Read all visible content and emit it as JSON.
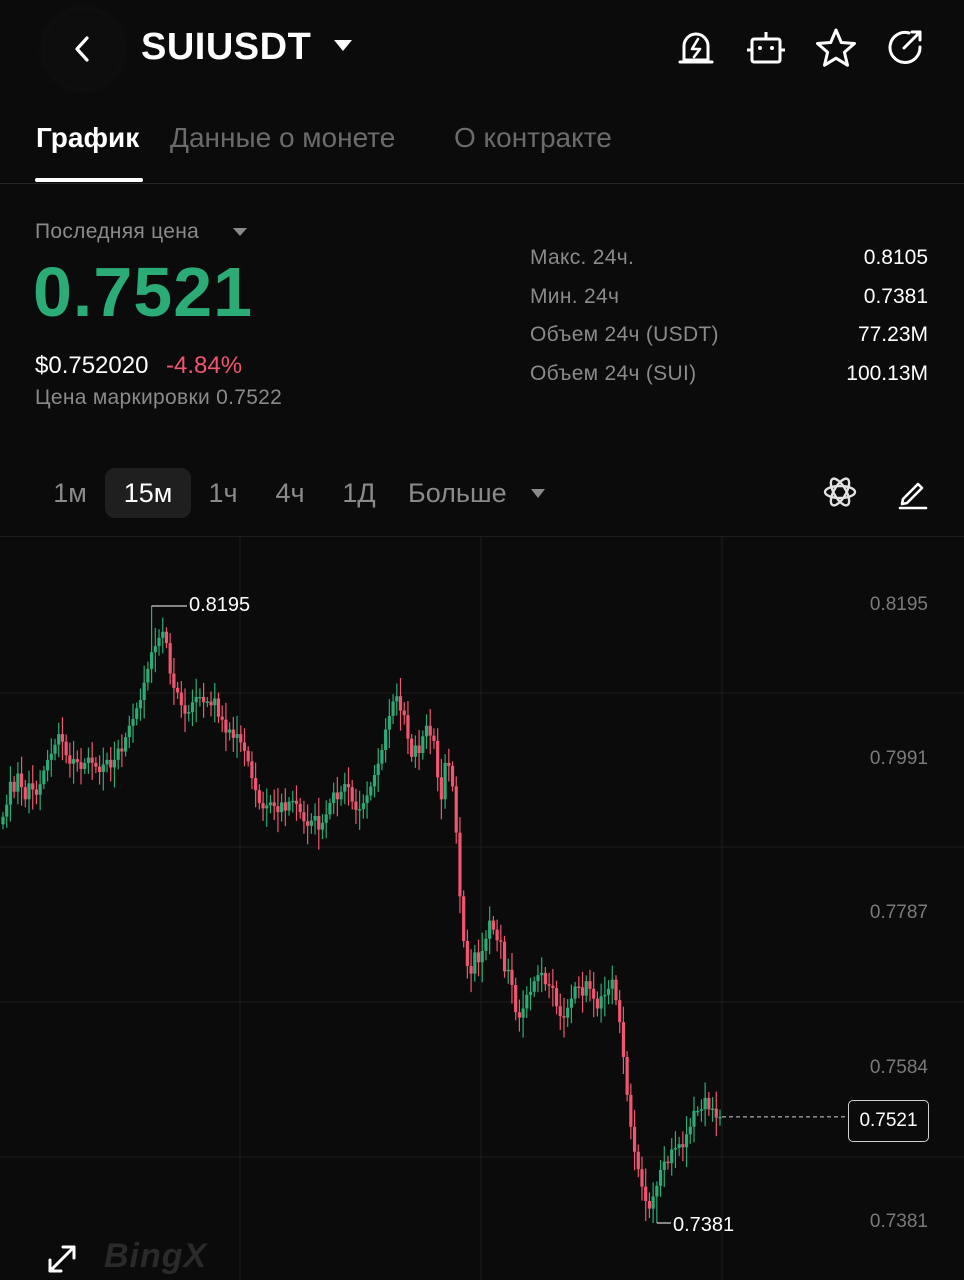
{
  "header": {
    "symbol": "SUIUSDT",
    "icons": [
      "back-icon",
      "caret-down-icon",
      "price-alert-icon",
      "trading-bot-icon",
      "star-icon",
      "share-icon"
    ]
  },
  "tabs": [
    {
      "label": "График",
      "active": true
    },
    {
      "label": "Данные о монете",
      "active": false
    },
    {
      "label": "О контракте",
      "active": false
    }
  ],
  "price": {
    "label": "Последняя цена",
    "last": "0.7521",
    "usd": "$0.752020",
    "change_pct": "-4.84%",
    "mark_label": "Цена маркировки 0.7522"
  },
  "stats": [
    {
      "label": "Макс. 24ч.",
      "value": "0.8105"
    },
    {
      "label": "Мин. 24ч",
      "value": "0.7381"
    },
    {
      "label": "Объем 24ч (USDT)",
      "value": "77.23M"
    },
    {
      "label": "Объем 24ч (SUI)",
      "value": "100.13M"
    }
  ],
  "intervals": {
    "items": [
      "1м",
      "15м",
      "1ч",
      "4ч",
      "1Д"
    ],
    "active": "15м",
    "more_label": "Больше"
  },
  "chart_watermark": "BingX",
  "colors": {
    "up": "#2bac76",
    "down": "#f0566f",
    "background": "#0b0b0b",
    "grid": "#1c1c1c"
  },
  "chart_data": {
    "type": "candlestick",
    "y_ticks": [
      "0.8195",
      "0.7991",
      "0.7787",
      "0.7584",
      "0.7381"
    ],
    "ylim": [
      0.7381,
      0.8195
    ],
    "high_marker": "0.8195",
    "low_marker": "0.7381",
    "current_price": "0.7521",
    "closes": [
      0.7917,
      0.7933,
      0.7963,
      0.795,
      0.7974,
      0.7956,
      0.794,
      0.7961,
      0.7953,
      0.7946,
      0.796,
      0.7978,
      0.7992,
      0.8,
      0.8012,
      0.8026,
      0.8016,
      0.7998,
      0.7987,
      0.7993,
      0.7989,
      0.798,
      0.7988,
      0.7995,
      0.7988,
      0.7983,
      0.7976,
      0.7986,
      0.7992,
      0.7982,
      0.7992,
      0.8007,
      0.8003,
      0.8022,
      0.8037,
      0.8046,
      0.806,
      0.8071,
      0.8094,
      0.8112,
      0.8134,
      0.8142,
      0.8153,
      0.8161,
      0.8146,
      0.8106,
      0.8087,
      0.8081,
      0.8064,
      0.8053,
      0.8055,
      0.8068,
      0.8075,
      0.8075,
      0.8068,
      0.8069,
      0.8064,
      0.8073,
      0.8049,
      0.8045,
      0.8028,
      0.8032,
      0.8021,
      0.8026,
      0.8015,
      0.8004,
      0.799,
      0.7968,
      0.7952,
      0.7935,
      0.7928,
      0.7932,
      0.7936,
      0.7931,
      0.7923,
      0.7936,
      0.7925,
      0.7937,
      0.7938,
      0.7934,
      0.7923,
      0.7911,
      0.7905,
      0.7912,
      0.7918,
      0.79,
      0.7909,
      0.792,
      0.7935,
      0.7949,
      0.794,
      0.795,
      0.796,
      0.7956,
      0.7937,
      0.7926,
      0.7927,
      0.7935,
      0.7945,
      0.7957,
      0.7972,
      0.7987,
      0.8005,
      0.8032,
      0.805,
      0.8069,
      0.8076,
      0.8057,
      0.8051,
      0.802,
      0.7996,
      0.8011,
      0.8001,
      0.8023,
      0.8037,
      0.8024,
      0.8017,
      0.7969,
      0.794,
      0.7988,
      0.7984,
      0.7957,
      0.7896,
      0.7812,
      0.7753,
      0.772,
      0.771,
      0.7738,
      0.7725,
      0.774,
      0.7756,
      0.778,
      0.7768,
      0.7754,
      0.7752,
      0.7713,
      0.7715,
      0.7695,
      0.7659,
      0.7652,
      0.7664,
      0.7682,
      0.7686,
      0.77,
      0.7708,
      0.7711,
      0.7696,
      0.7694,
      0.7691,
      0.7667,
      0.7654,
      0.7652,
      0.7665,
      0.7677,
      0.7693,
      0.7692,
      0.7681,
      0.77,
      0.769,
      0.7677,
      0.7664,
      0.768,
      0.7682,
      0.769,
      0.7702,
      0.7675,
      0.7646,
      0.76,
      0.755,
      0.7508,
      0.7475,
      0.7452,
      0.7429,
      0.741,
      0.74,
      0.7416,
      0.743,
      0.7451,
      0.7462,
      0.746,
      0.7478,
      0.748,
      0.7485,
      0.7481,
      0.7498,
      0.7508,
      0.7529,
      0.7529,
      0.7531,
      0.7546,
      0.7531,
      0.7532,
      0.752,
      0.7521
    ]
  }
}
